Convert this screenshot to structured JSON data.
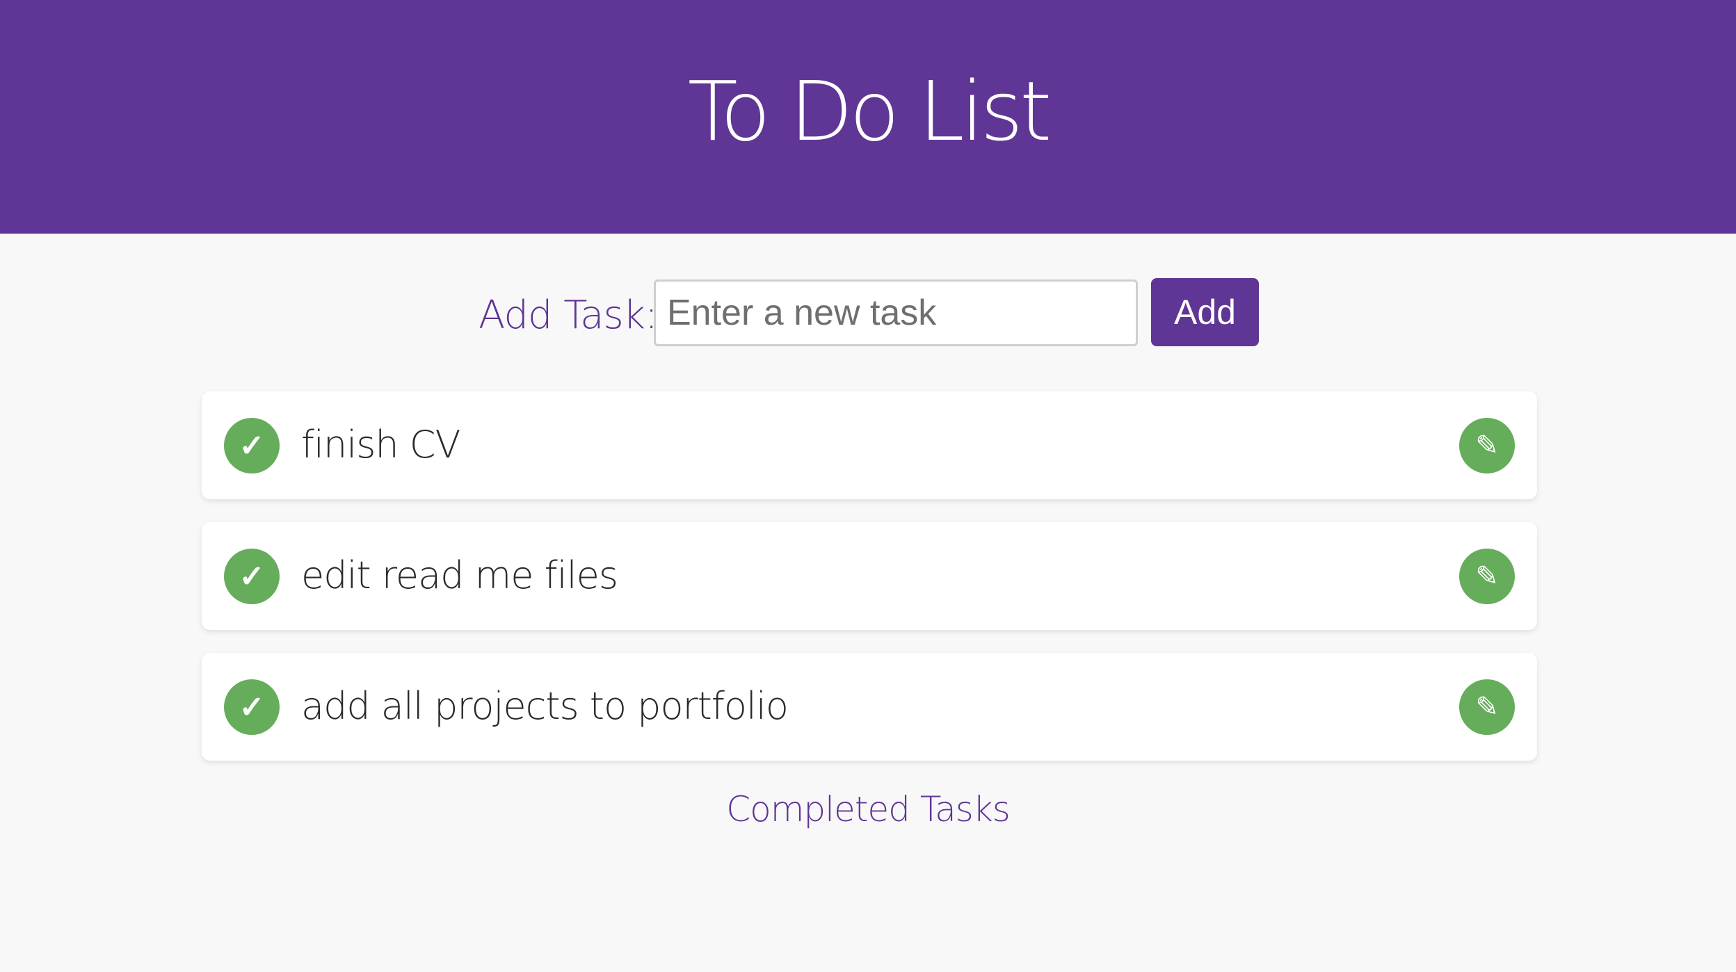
{
  "header": {
    "title": "To Do List"
  },
  "add_task": {
    "label": "Add Task:",
    "input_value": "",
    "placeholder": "Enter a new task",
    "button_label": "Add"
  },
  "tasks": [
    {
      "text": "finish CV",
      "complete_icon": "✓",
      "edit_icon": "✎"
    },
    {
      "text": "edit read me files",
      "complete_icon": "✓",
      "edit_icon": "✎"
    },
    {
      "text": "add all projects to portfolio",
      "complete_icon": "✓",
      "edit_icon": "✎"
    }
  ],
  "footer": {
    "completed_link": "Completed Tasks"
  },
  "colors": {
    "brand_purple": "#5f3595",
    "action_green": "#66ad5b",
    "background": "#f8f8f8"
  },
  "icons": {
    "complete": "check-icon",
    "edit": "pencil-icon"
  }
}
